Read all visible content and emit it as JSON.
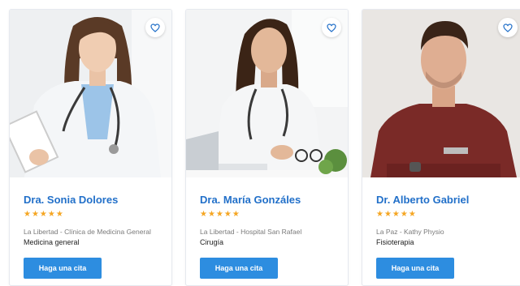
{
  "colors": {
    "accent": "#2270c9",
    "button": "#2d8de0",
    "star": "#f5a623"
  },
  "doctors": [
    {
      "name": "Dra. Sonia Dolores",
      "rating": 5,
      "stars": "★★★★★",
      "location": "La Libertad - Clínica de Medicina General",
      "specialty": "Medicina general",
      "cta": "Haga una cita",
      "favorite_icon": "heart-outline"
    },
    {
      "name": "Dra. María Gonzáles",
      "rating": 5,
      "stars": "★★★★★",
      "location": "La Libertad - Hospital San Rafael",
      "specialty": "Cirugía",
      "cta": "Haga una cita",
      "favorite_icon": "heart-outline"
    },
    {
      "name": "Dr. Alberto Gabriel",
      "rating": 5,
      "stars": "★★★★★",
      "location": "La Paz - Kathy Physio",
      "specialty": "Fisioterapia",
      "cta": "Haga una cita",
      "favorite_icon": "heart-outline"
    }
  ]
}
